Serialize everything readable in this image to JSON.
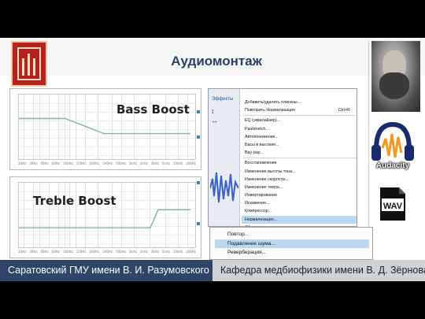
{
  "title": "Аудиомонтаж",
  "charts": [
    {
      "label": "Bass Boost",
      "tick_labels": [
        "20Hz",
        "30Hz",
        "40Hz",
        "60Hz",
        "100Hz",
        "150Hz",
        "200Hz",
        "300Hz",
        "500Hz",
        "1kHz",
        "2kHz",
        "3kHz",
        "5kHz",
        "10kHz",
        "20kHz"
      ]
    },
    {
      "label": "Treble Boost",
      "tick_labels": [
        "20Hz",
        "30Hz",
        "40Hz",
        "60Hz",
        "100Hz",
        "150Hz",
        "200Hz",
        "300Hz",
        "500Hz",
        "1kHz",
        "2kHz",
        "3kHz",
        "5kHz",
        "10kHz",
        "20kHz"
      ]
    }
  ],
  "effects_menu": {
    "side_title": "Эффекты",
    "items": [
      {
        "label": "Добавить/удалить плагины...",
        "shortcut": ""
      },
      {
        "label": "Повторить Нормализация",
        "shortcut": "Ctrl+R"
      },
      {
        "label": "EQ (эквалайзер)...",
        "shortcut": ""
      },
      {
        "label": "Paulstretch...",
        "shortcut": ""
      },
      {
        "label": "Автопонижение...",
        "shortcut": ""
      },
      {
        "label": "Басы и высокие...",
        "shortcut": ""
      },
      {
        "label": "Bay-bay...",
        "shortcut": ""
      },
      {
        "label": "Восстановление",
        "shortcut": ""
      },
      {
        "label": "Изменение высоты тона...",
        "shortcut": ""
      },
      {
        "label": "Изменение скорости...",
        "shortcut": ""
      },
      {
        "label": "Изменение темпа...",
        "shortcut": ""
      },
      {
        "label": "Инвертирование",
        "shortcut": ""
      },
      {
        "label": "Искажение...",
        "shortcut": ""
      },
      {
        "label": "Компрессор...",
        "shortcut": ""
      },
      {
        "label": "Нормализация...",
        "shortcut": ""
      },
      {
        "label": "Обрезка клипов",
        "shortcut": ""
      }
    ],
    "selected_index": 14
  },
  "noise_menu": {
    "items": [
      "Повтор...",
      "Подавление шума...",
      "Реверберация..."
    ],
    "selected_index": 1
  },
  "audacity_label": "Audacity",
  "wav_label": "WAV",
  "footer": {
    "left": "Саратовский ГМУ имени В. И. Разумовского",
    "right": "Кафедра медбиофизики имени В. Д. Зёрнова"
  },
  "colors": {
    "title": "#2a3f66",
    "footer_left": "#2e4568",
    "footer_right": "#cfd3d8",
    "curve": "#7fb3b0",
    "selection": "#bed7f0"
  }
}
